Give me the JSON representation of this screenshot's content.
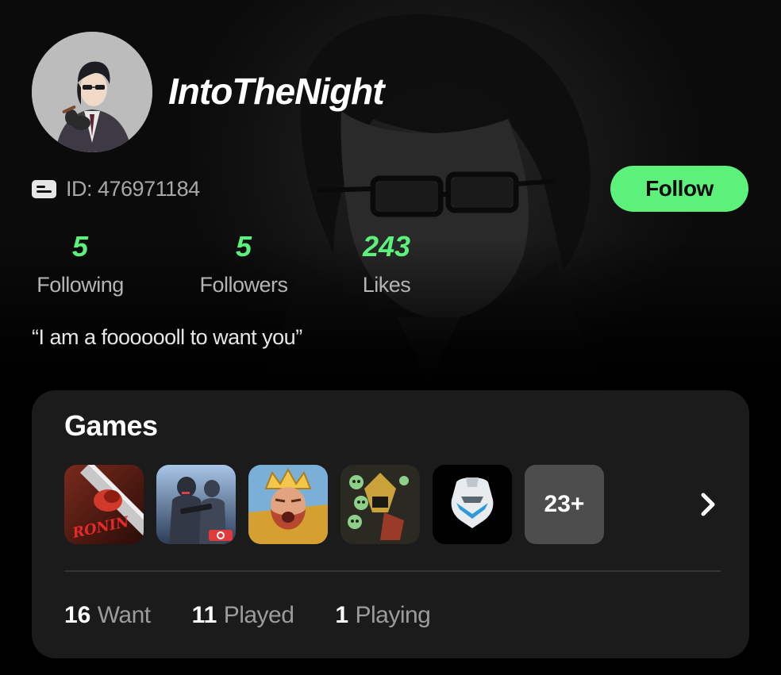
{
  "profile": {
    "username": "IntoTheNight",
    "id_label": "ID: 476971184",
    "follow_label": "Follow",
    "bio": "“I am a fooooooll to want you”"
  },
  "stats": {
    "following": {
      "value": "5",
      "label": "Following"
    },
    "followers": {
      "value": "5",
      "label": "Followers"
    },
    "likes": {
      "value": "243",
      "label": "Likes"
    }
  },
  "games": {
    "title": "Games",
    "thumbnails": [
      {
        "icon": "ronin-game-icon",
        "text": "RONIN"
      },
      {
        "icon": "shooter-game-icon",
        "text": ""
      },
      {
        "icon": "king-game-icon",
        "text": ""
      },
      {
        "icon": "samurai-skull-game-icon",
        "text": ""
      },
      {
        "icon": "halo-helmet-game-icon",
        "text": ""
      }
    ],
    "more_label": "23+",
    "counts": {
      "want": {
        "value": "16",
        "label": "Want"
      },
      "played": {
        "value": "11",
        "label": "Played"
      },
      "playing": {
        "value": "1",
        "label": "Playing"
      }
    }
  },
  "colors": {
    "accent": "#5cf17a",
    "card_bg": "#1b1b1b",
    "background": "#000000"
  }
}
